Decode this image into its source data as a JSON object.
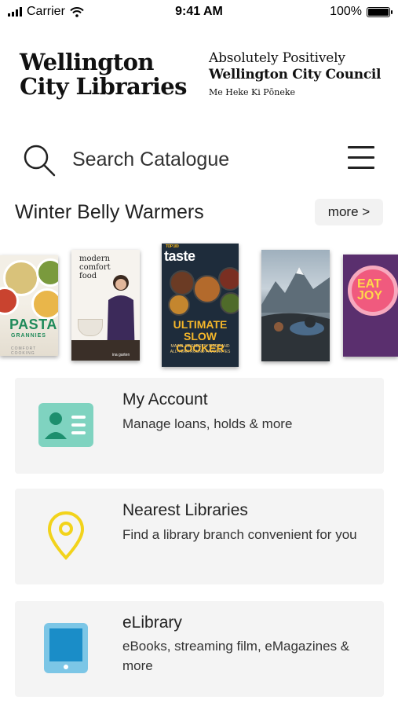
{
  "status_bar": {
    "carrier": "Carrier",
    "time": "9:41 AM",
    "battery": "100%"
  },
  "header": {
    "logo_left_line1": "Wellington",
    "logo_left_line2": "City Libraries",
    "logo_right_line1": "Absolutely Positively",
    "logo_right_line2": "Wellington City Council",
    "logo_right_line3": "Me Heke Ki Pōneke"
  },
  "search": {
    "placeholder": "Search Catalogue"
  },
  "section": {
    "title": "Winter Belly Warmers",
    "more_label": "more >"
  },
  "covers": [
    {
      "name": "pasta-grannies",
      "text": [
        "PASTA",
        "GRANNIES",
        "COMFORT COOKING"
      ]
    },
    {
      "name": "modern-comfort-food",
      "text": [
        "modern",
        "comfort",
        "food",
        "ina garten"
      ]
    },
    {
      "name": "ultimate-slow-cooker",
      "text": [
        "TOP 100",
        "taste",
        "ULTIMATE",
        "SLOW COOKER",
        "MAINS, DESSERTS, SIDES AND",
        "ALL-YEAR ROUND FAVOURITES"
      ]
    },
    {
      "name": "mountain-book",
      "text": []
    },
    {
      "name": "eat-joy",
      "text": [
        "EAT",
        "JOY"
      ]
    }
  ],
  "cards": [
    {
      "title": "My Account",
      "subtitle": "Manage loans, holds & more",
      "icon": "id-card-icon"
    },
    {
      "title": "Nearest Libraries",
      "subtitle": "Find a library branch convenient for you",
      "icon": "map-pin-icon"
    },
    {
      "title": "eLibrary",
      "subtitle": "eBooks, streaming film, eMagazines & more",
      "icon": "tablet-icon"
    }
  ],
  "colors": {
    "account_icon": "#7fd3c0",
    "pin_icon": "#f2d31b",
    "tablet_frame": "#7cc6e6",
    "tablet_screen": "#1a8dc8",
    "card_bg": "#f4f4f4"
  }
}
